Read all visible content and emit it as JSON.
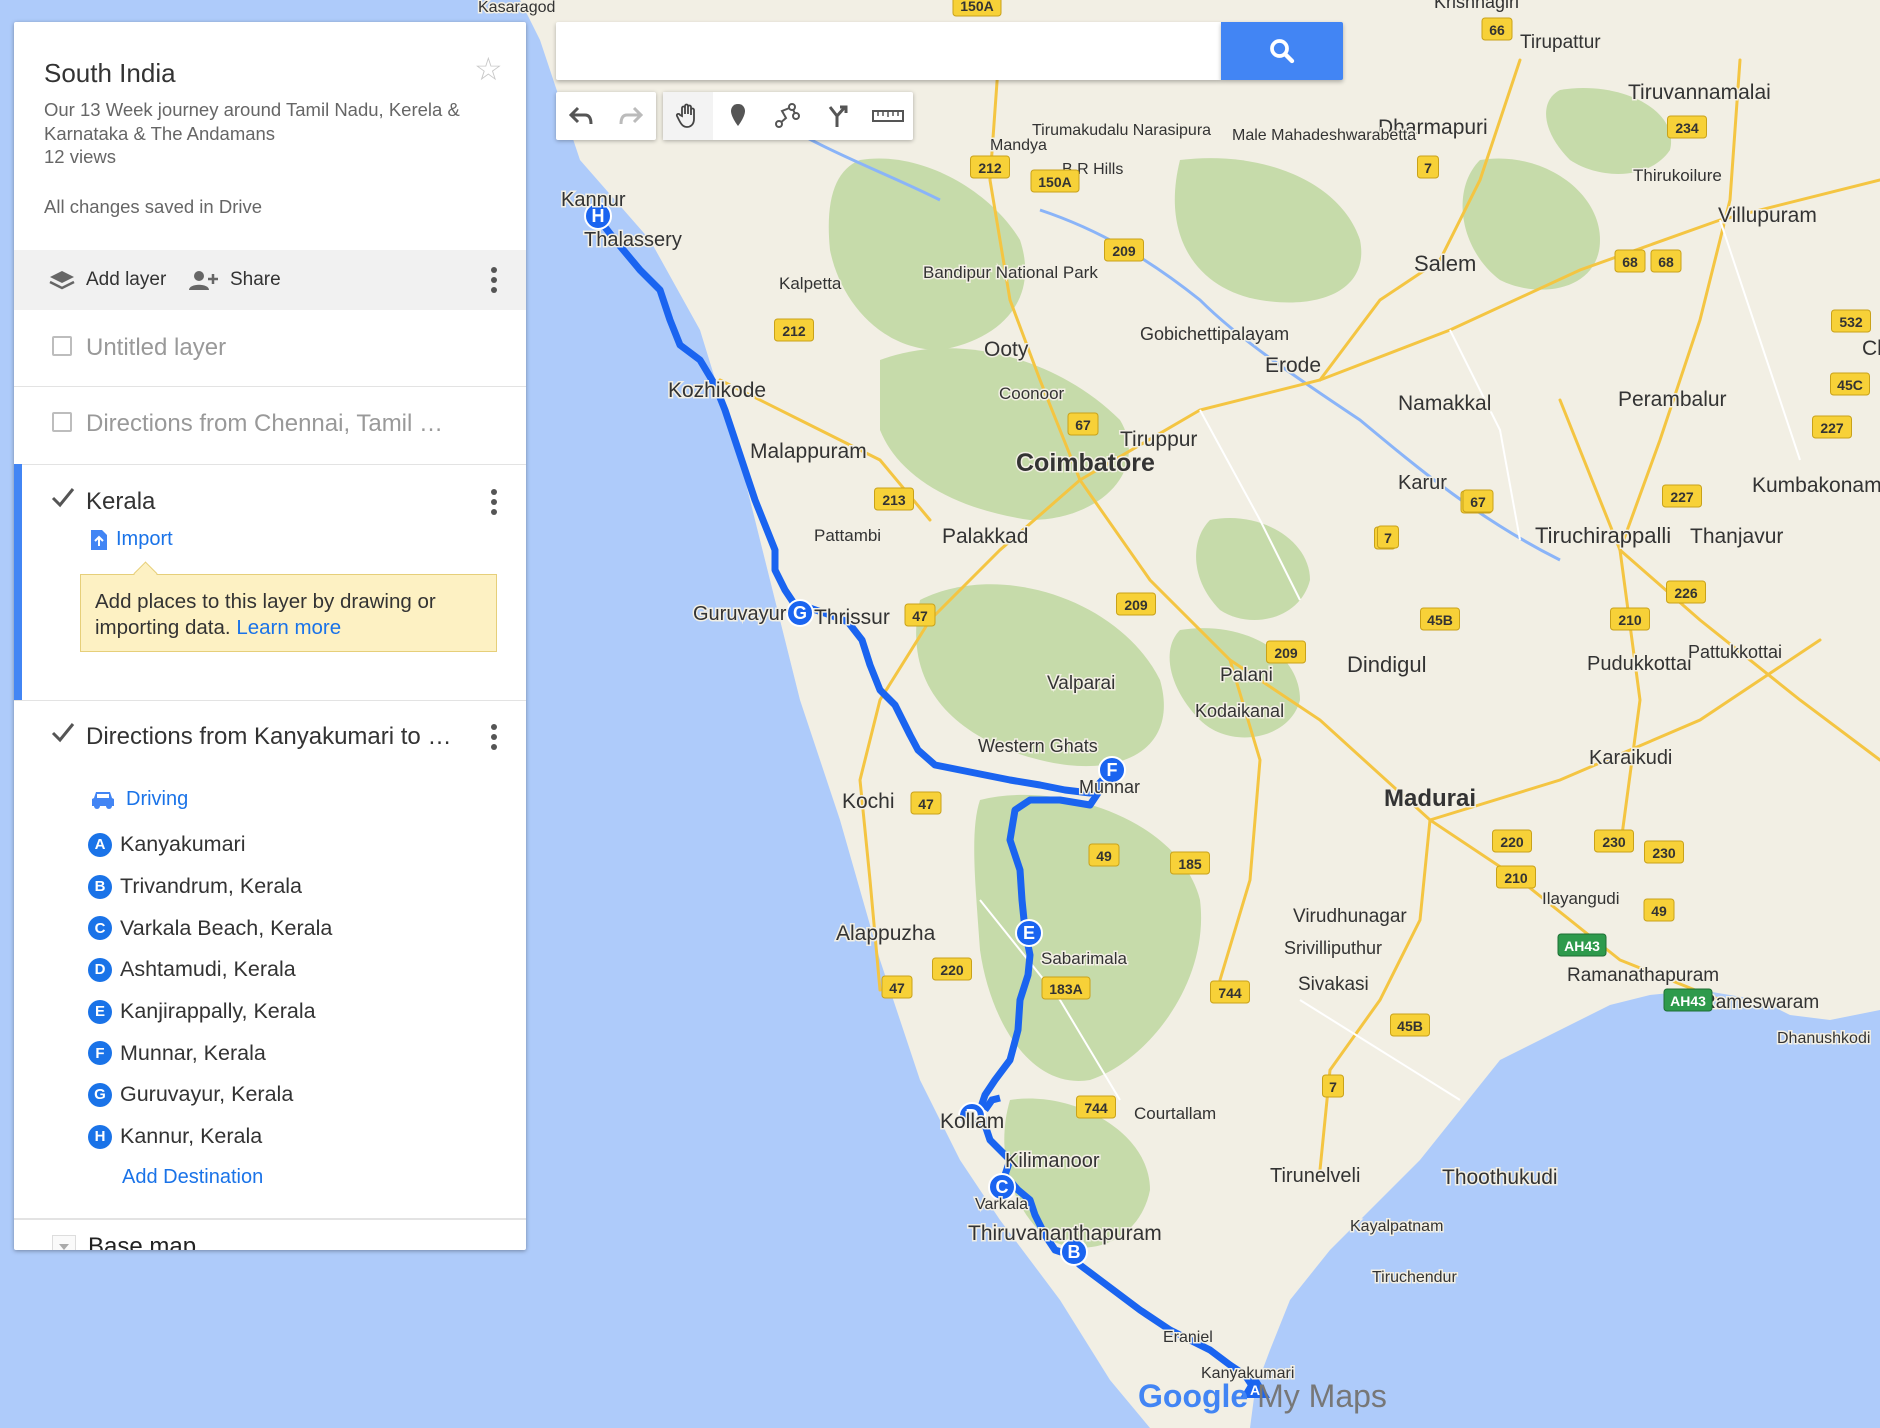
{
  "map": {
    "watermark_brand": "Google",
    "watermark_product": "My Maps",
    "labels": {
      "cities": [
        "Kasaragod",
        "Kannur",
        "Thalassery",
        "Kozhikode",
        "Malappuram",
        "Kalpetta",
        "Bandipur National Park",
        "Ooty",
        "Coonoor",
        "Coimbatore",
        "Tiruppur",
        "Erode",
        "Gobichettipalayam",
        "Salem",
        "Namakkal",
        "Dharmapuri",
        "Krishnagiri",
        "Tirupattur",
        "Tiruvannamalai",
        "Thirukoilure",
        "Villupuram",
        "Perambalur",
        "Chic",
        "Kumbakonam",
        "Thanjavur",
        "Tiruchirappalli",
        "Karur",
        "Pudukkottai",
        "Pattukkottai",
        "Karaikudi",
        "Madurai",
        "Dindigul",
        "Palani",
        "Kodaikanal",
        "Valparai",
        "Western Ghats",
        "Munnar",
        "Palakkad",
        "Pattambi",
        "Guruvayur",
        "Thrissur",
        "Kochi",
        "Alappuzha",
        "Sabarimala",
        "Virudhunagar",
        "Srivilliputhur",
        "Sivakasi",
        "Ilayangudi",
        "Ramanathapuram",
        "Rameswaram",
        "Dhanushkodi",
        "Kollam",
        "Kilimanoor",
        "Varkala",
        "Thiruvananthapuram",
        "Courtallam",
        "Tirunelveli",
        "Thoothukudi",
        "Kayalpatnam",
        "Tiruchendur",
        "Eraniel",
        "Kanyakumari",
        "Tirumakudalu Narasipura",
        "Mandya",
        "Male Mahadeshwarabetta",
        "B R Hills"
      ],
      "shields": [
        "150A",
        "212",
        "150A",
        "209",
        "212",
        "68",
        "532",
        "45C",
        "227",
        "227",
        "67",
        "7",
        "67",
        "47",
        "7",
        "209",
        "209",
        "45B",
        "210",
        "226",
        "47",
        "49",
        "185",
        "220",
        "230",
        "230",
        "210",
        "49",
        "210",
        "AH43",
        "AH43",
        "45B",
        "744",
        "183A",
        "220",
        "47",
        "7",
        "744",
        "68",
        "234",
        "7",
        "66",
        "213",
        "67",
        "67"
      ]
    },
    "route_markers": [
      "A",
      "B",
      "C",
      "D",
      "E",
      "F",
      "G",
      "H"
    ]
  },
  "panel": {
    "title": "South India",
    "description": "Our 13 Week journey around Tamil Nadu, Kerela & Karnataka & The Andamans",
    "views": "12 views",
    "save_status": "All changes saved in Drive",
    "add_layer": "Add layer",
    "share": "Share",
    "layers": [
      {
        "name": "Untitled layer",
        "checked": false
      },
      {
        "name": "Directions from Chennai, Tamil …",
        "checked": false
      },
      {
        "name": "Kerala",
        "checked": true,
        "import_label": "Import",
        "notice": "Add places to this layer by drawing or importing data.",
        "notice_link": "Learn more"
      },
      {
        "name": "Directions from Kanyakumari to …",
        "checked": true,
        "mode": "Driving",
        "stops": [
          {
            "letter": "A",
            "name": "Kanyakumari"
          },
          {
            "letter": "B",
            "name": "Trivandrum, Kerala"
          },
          {
            "letter": "C",
            "name": "Varkala Beach, Kerala"
          },
          {
            "letter": "D",
            "name": "Ashtamudi, Kerala"
          },
          {
            "letter": "E",
            "name": "Kanjirappally, Kerala"
          },
          {
            "letter": "F",
            "name": "Munnar, Kerala"
          },
          {
            "letter": "G",
            "name": "Guruvayur, Kerala"
          },
          {
            "letter": "H",
            "name": "Kannur, Kerala"
          }
        ],
        "add_destination": "Add Destination"
      }
    ],
    "base_map": "Base map"
  },
  "search": {
    "value": "",
    "placeholder": ""
  },
  "colors": {
    "route": "#1a64f0",
    "accent": "#4285f4",
    "sea": "#aecbfa",
    "land": "#f2efe4",
    "forest": "#c6dbaa",
    "shield": "#f7d138",
    "green_shield": "#2e9a4c"
  }
}
